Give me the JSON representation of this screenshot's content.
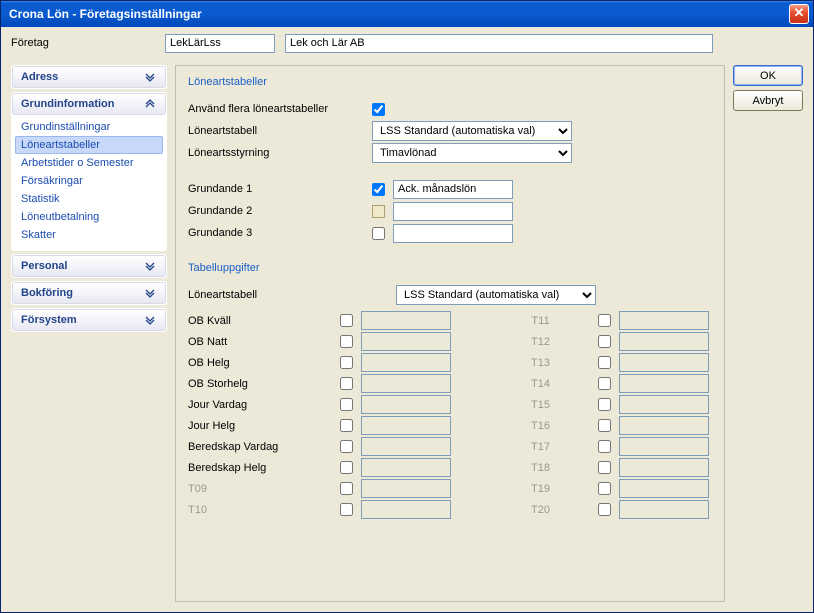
{
  "window": {
    "title": "Crona Lön - Företagsinställningar"
  },
  "company": {
    "label": "Företag",
    "code": "LekLärLss",
    "name": "Lek och Lär AB"
  },
  "sidebar": {
    "sections": [
      {
        "label": "Adress",
        "expanded": false
      },
      {
        "label": "Grundinformation",
        "expanded": true,
        "items": [
          {
            "label": "Grundinställningar"
          },
          {
            "label": "Löneartstabeller",
            "selected": true
          },
          {
            "label": "Arbetstider o Semester"
          },
          {
            "label": "Försäkringar"
          },
          {
            "label": "Statistik"
          },
          {
            "label": "Löneutbetalning"
          },
          {
            "label": "Skatter"
          }
        ]
      },
      {
        "label": "Personal",
        "expanded": false
      },
      {
        "label": "Bokföring",
        "expanded": false
      },
      {
        "label": "Försystem",
        "expanded": false
      }
    ]
  },
  "buttons": {
    "ok": "OK",
    "cancel": "Avbryt"
  },
  "loneart": {
    "title": "Löneartstabeller",
    "use_multi_label": "Använd flera löneartstabeller",
    "use_multi": true,
    "table_label": "Löneartstabell",
    "table_value": "LSS Standard (automatiska val)",
    "styrning_label": "Löneartsstyrning",
    "styrning_value": "Timavlönad",
    "grundande": [
      {
        "label": "Grundande 1",
        "checked": true,
        "value": "Ack. månadslön"
      },
      {
        "label": "Grundande 2",
        "checked": null,
        "value": ""
      },
      {
        "label": "Grundande 3",
        "checked": false,
        "value": ""
      }
    ]
  },
  "tabell": {
    "title": "Tabelluppgifter",
    "table_label": "Löneartstabell",
    "table_value": "LSS Standard (automatiska val)",
    "rows": [
      {
        "l1": "OB Kväll",
        "dim1": false,
        "l2": "T11"
      },
      {
        "l1": "OB Natt",
        "dim1": false,
        "l2": "T12"
      },
      {
        "l1": "OB Helg",
        "dim1": false,
        "l2": "T13"
      },
      {
        "l1": "OB Storhelg",
        "dim1": false,
        "l2": "T14"
      },
      {
        "l1": "Jour Vardag",
        "dim1": false,
        "l2": "T15"
      },
      {
        "l1": "Jour Helg",
        "dim1": false,
        "l2": "T16"
      },
      {
        "l1": "Beredskap Vardag",
        "dim1": false,
        "l2": "T17"
      },
      {
        "l1": "Beredskap Helg",
        "dim1": false,
        "l2": "T18"
      },
      {
        "l1": "T09",
        "dim1": true,
        "l2": "T19"
      },
      {
        "l1": "T10",
        "dim1": true,
        "l2": "T20"
      }
    ]
  }
}
